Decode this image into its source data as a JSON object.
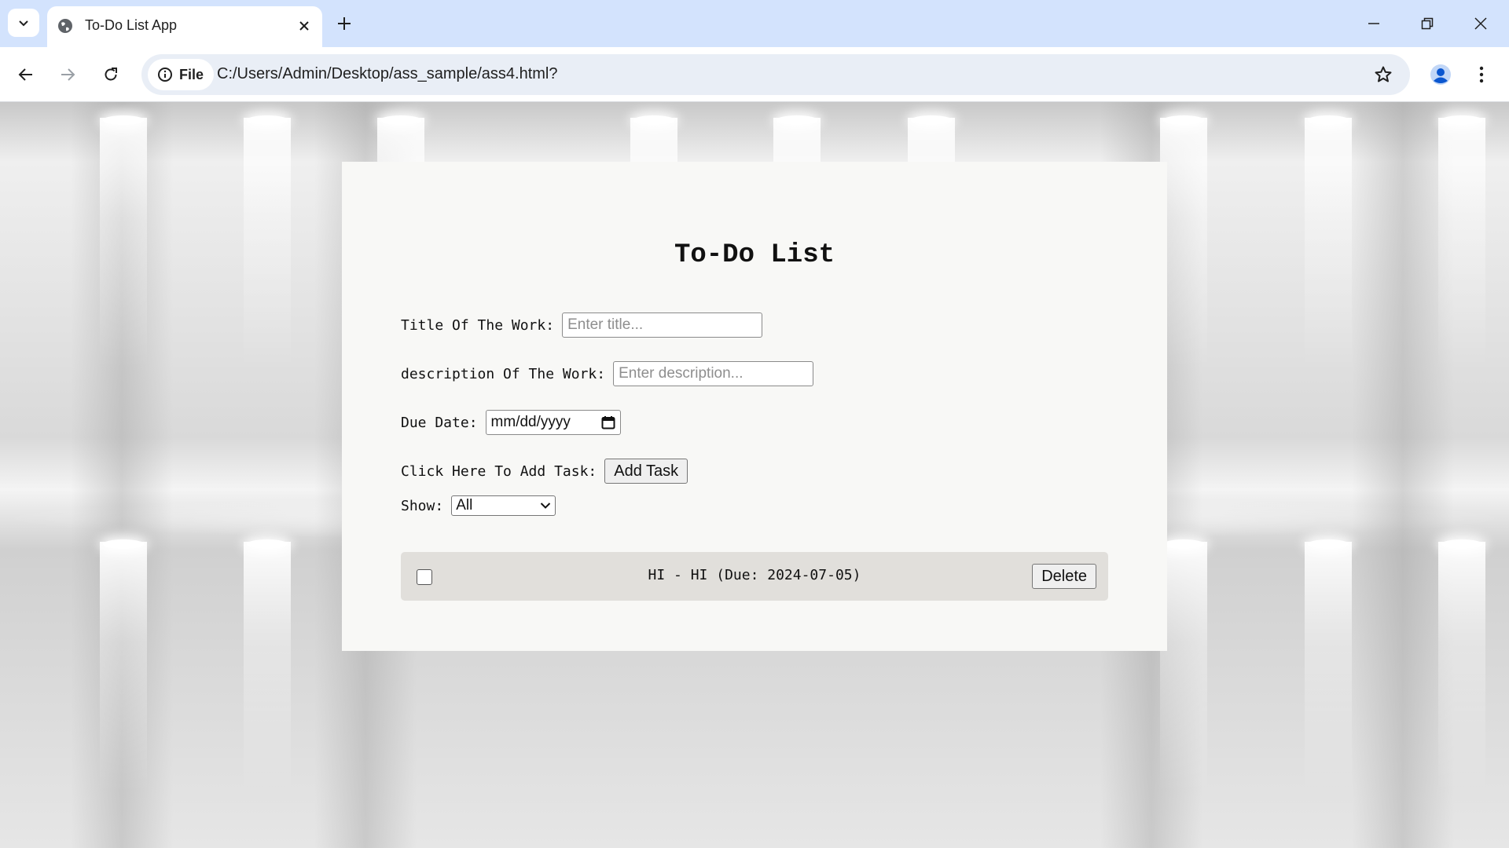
{
  "browser": {
    "tab_title": "To-Do List App",
    "file_chip_label": "File",
    "url": "C:/Users/Admin/Desktop/ass_sample/ass4.html?",
    "icons": [
      "tab-search-icon",
      "globe-icon",
      "close-icon",
      "plus-icon",
      "minimize-icon",
      "restore-icon",
      "close-window-icon",
      "back-arrow-icon",
      "forward-arrow-icon",
      "reload-icon",
      "info-icon",
      "star-icon",
      "profile-icon",
      "kebab-menu-icon"
    ]
  },
  "app": {
    "heading": "To-Do List",
    "title_field": {
      "label": "Title Of The Work:",
      "placeholder": "Enter title..."
    },
    "description_field": {
      "label": "description Of The Work:",
      "placeholder": "Enter description..."
    },
    "due_date_field": {
      "label": "Due Date:",
      "placeholder": "mm/dd/yyyy"
    },
    "add_task": {
      "label": "Click Here To Add Task:",
      "button": "Add Task"
    },
    "filter": {
      "label": "Show:",
      "selected": "All"
    },
    "tasks": [
      {
        "text": "HI - HI (Due: 2024-07-05)",
        "completed": false,
        "delete_label": "Delete"
      }
    ]
  }
}
